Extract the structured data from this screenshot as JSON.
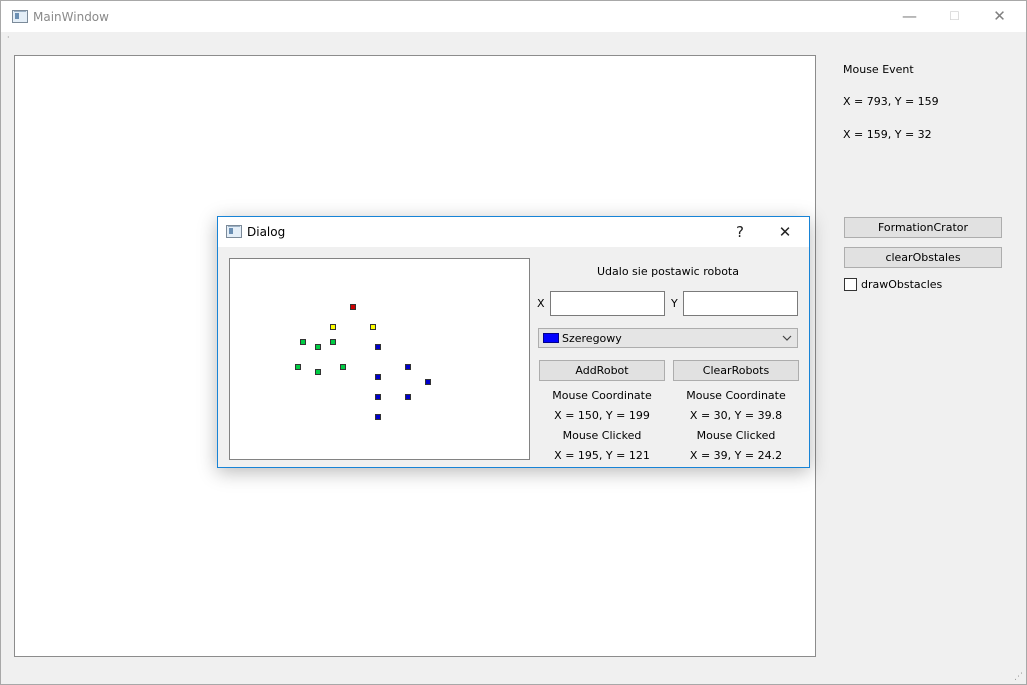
{
  "main_window": {
    "title": "MainWindow",
    "controls": {
      "minimize": "—",
      "maximize": "☐",
      "close": "✕"
    },
    "menu_indicator": "·"
  },
  "side_panel": {
    "mouse_event_label": "Mouse Event",
    "coord_line_1": "X = 793, Y = 159",
    "coord_line_2": "X = 159, Y = 32",
    "formation_button": "FormationCrator",
    "clear_obstacles_button": "clearObstales",
    "draw_obstacles_checkbox": {
      "label": "drawObstacles",
      "checked": false
    }
  },
  "dialog": {
    "title": "Dialog",
    "help": "?",
    "close": "✕",
    "status_text": "Udalo sie postawic robota",
    "x_label": "X",
    "y_label": "Y",
    "x_value": "",
    "y_value": "",
    "formation_select": {
      "selected": "Szeregowy",
      "swatch_color": "#0000ff"
    },
    "add_robot_button": "AddRobot",
    "clear_robots_button": "ClearRobots",
    "left_info": {
      "coord_label": "Mouse Coordinate",
      "coord_value": "X = 150, Y = 199",
      "clicked_label": "Mouse Clicked",
      "clicked_value": "X = 195, Y = 121"
    },
    "right_info": {
      "coord_label": "Mouse Coordinate",
      "coord_value": "X = 30, Y = 39.8",
      "clicked_label": "Mouse Clicked",
      "clicked_value": "X = 39, Y = 24.2"
    },
    "colors": {
      "red": "#cc0000",
      "yellow": "#ffff00",
      "green": "#00cc44",
      "blue": "#0000cc"
    }
  }
}
